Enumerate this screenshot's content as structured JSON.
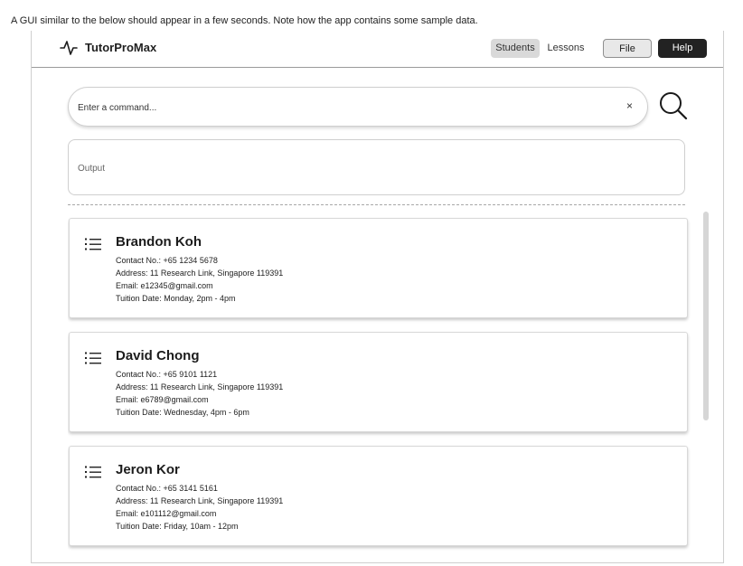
{
  "caption": "A GUI similar to the below should appear in a few seconds. Note how the app contains some sample data.",
  "app": {
    "title": "TutorProMax",
    "nav": {
      "students": "Students",
      "lessons": "Lessons"
    },
    "file_label": "File",
    "help_label": "Help"
  },
  "command": {
    "placeholder": "Enter a command...",
    "clear": "×"
  },
  "output": {
    "label": "Output"
  },
  "students": [
    {
      "name": "Brandon Koh",
      "contact": "Contact No.: +65 1234 5678",
      "address": "Address: 11 Research Link, Singapore 119391",
      "email": "Email: e12345@gmail.com",
      "tuition": "Tuition Date: Monday, 2pm - 4pm"
    },
    {
      "name": "David Chong",
      "contact": "Contact No.: +65 9101 1121",
      "address": "Address: 11 Research Link, Singapore 119391",
      "email": "Email: e6789@gmail.com",
      "tuition": "Tuition Date: Wednesday, 4pm - 6pm"
    },
    {
      "name": "Jeron Kor",
      "contact": "Contact No.: +65 3141 5161",
      "address": "Address: 11 Research Link, Singapore 119391",
      "email": "Email: e101112@gmail.com",
      "tuition": "Tuition Date: Friday, 10am - 12pm"
    }
  ],
  "icons": {
    "logo": "activity-pulse-icon",
    "search": "search-icon",
    "card": "list-icon"
  },
  "colors": {
    "active_tab": "#d9d9d9",
    "help_button": "#222222",
    "border": "#cfcfcf"
  }
}
